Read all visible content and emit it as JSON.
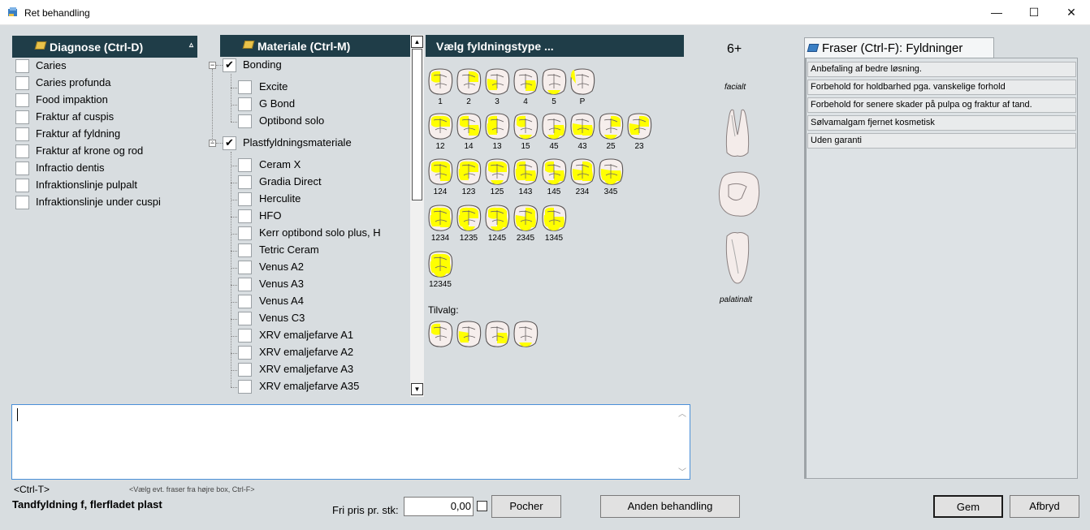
{
  "window": {
    "title": "Ret behandling",
    "minimize": "—",
    "maximize": "☐",
    "close": "✕"
  },
  "diagnose": {
    "header": "Diagnose (Ctrl-D)",
    "sort_glyph": "▵",
    "items": [
      "Caries",
      "Caries profunda",
      "Food impaktion",
      "Fraktur af cuspis",
      "Fraktur af fyldning",
      "Fraktur af krone og rod",
      "Infractio dentis",
      "Infraktionslinje pulpalt",
      "Infraktionslinje under cuspi"
    ]
  },
  "materiale": {
    "header": "Materiale (Ctrl-M)",
    "groups": [
      {
        "label": "Bonding",
        "checked": true,
        "expander": "−",
        "items": [
          "Excite",
          "G Bond",
          "Optibond solo"
        ]
      },
      {
        "label": "Plastfyldningsmateriale",
        "checked": true,
        "expander": "−",
        "items": [
          "Ceram X",
          "Gradia Direct",
          "Herculite",
          "HFO",
          "Kerr optibond solo plus, H",
          "Tetric Ceram",
          "Venus A2",
          "Venus A3",
          "Venus A4",
          "Venus C3",
          "XRV emaljefarve  A1",
          "XRV emaljefarve  A2",
          "XRV emaljefarve A3",
          "XRV emaljefarve A35"
        ]
      }
    ],
    "scroll_up": "▲",
    "scroll_down": "▼"
  },
  "fyldning": {
    "header": "Vælg fyldningstype ...",
    "rows": [
      [
        "1",
        "2",
        "3",
        "4",
        "5",
        "P"
      ],
      [
        "12",
        "14",
        "13",
        "15",
        "45",
        "43",
        "25",
        "23"
      ],
      [
        "124",
        "123",
        "125",
        "143",
        "145",
        "234",
        "345"
      ],
      [
        "1234",
        "1235",
        "1245",
        "2345",
        "1345"
      ],
      [
        "12345"
      ]
    ],
    "tilvalg_label": "Tilvalg:",
    "fill_color": "#ffff00"
  },
  "tooth_view": {
    "number": "6+",
    "facialt": "facialt",
    "palatinalt": "palatinalt"
  },
  "fraser": {
    "tab": "Fraser (Ctrl-F): Fyldninger",
    "items": [
      "Anbefaling af bedre løsning.",
      "Forbehold for holdbarhed pga. vanskelige forhold",
      "Forbehold for senere skader på pulpa og fraktur af tand.",
      "Sølvamalgam fjernet kosmetisk",
      "Uden garanti"
    ]
  },
  "notes": {
    "value": "",
    "scroll_up": "︿",
    "scroll_down": "﹀"
  },
  "footer": {
    "ctrl_t": "<Ctrl-T>",
    "hint": "<Vælg evt. fraser fra højre box, Ctrl-F>",
    "treatment": "Tandfyldning f, flerfladet plast",
    "price_label": "Fri pris pr. stk:",
    "price_value": "0,00",
    "pocher": "Pocher",
    "anden": "Anden behandling",
    "gem": "Gem",
    "afbryd": "Afbryd"
  }
}
